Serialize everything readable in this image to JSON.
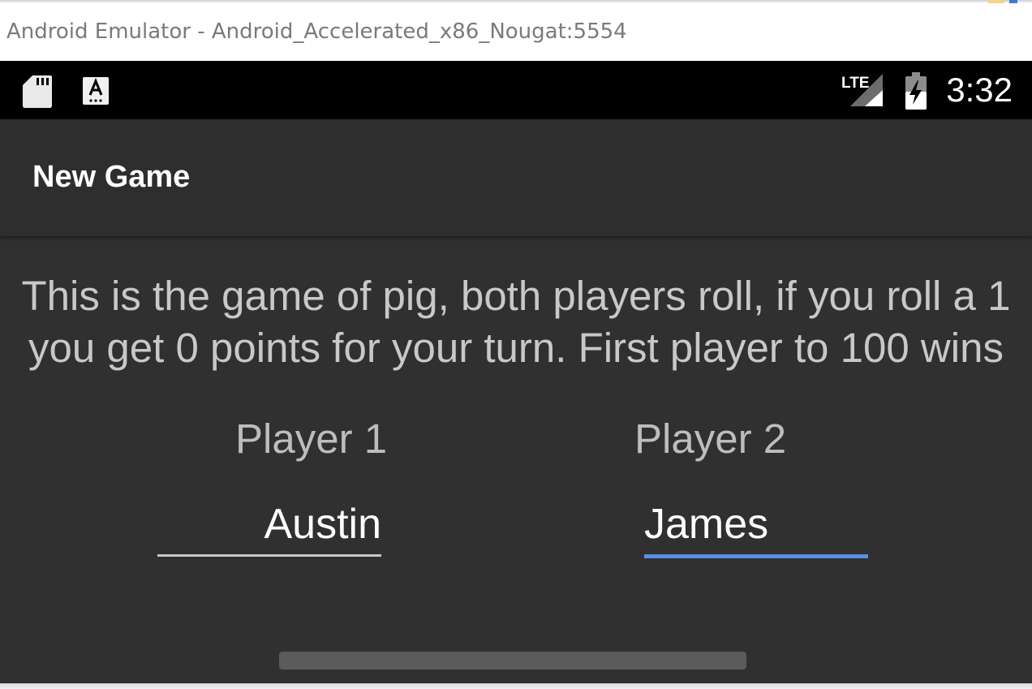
{
  "window": {
    "title": "Android Emulator - Android_Accelerated_x86_Nougat:5554"
  },
  "statusbar": {
    "left_icons": [
      "sd-card-icon",
      "keyboard-input-icon"
    ],
    "right_icons": [
      "lte-signal-icon",
      "battery-charging-icon"
    ],
    "network_label": "LTE",
    "time": "3:32"
  },
  "appbar": {
    "title": "New Game"
  },
  "main": {
    "description_line1": "This is the game of pig, both players roll, if you roll a 1",
    "description_line2": "you get 0 points for your turn. First player to 100 wins",
    "player1": {
      "label": "Player 1",
      "name_value": "Austin"
    },
    "player2": {
      "label": "Player 2",
      "name_value": "James"
    }
  },
  "colors": {
    "background": "#303030",
    "appbar": "#2e2e2e",
    "accent_focus": "#5b8de3",
    "underline_idle": "#c8c8c8",
    "text_primary": "#ffffff",
    "text_secondary": "#c8c8c8"
  }
}
